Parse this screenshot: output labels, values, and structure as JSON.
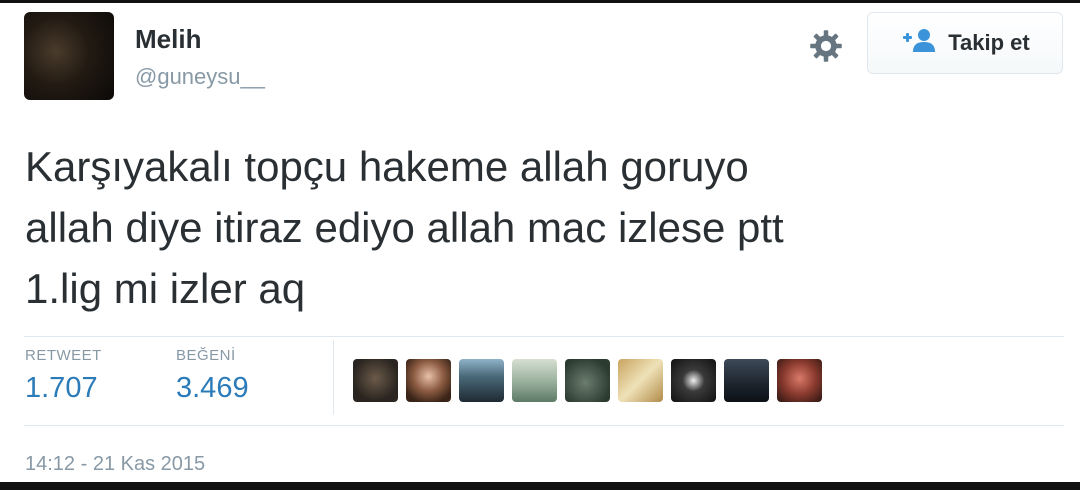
{
  "user": {
    "display_name": "Melih",
    "username": "@guneysu__"
  },
  "actions": {
    "follow_label": "Takip et",
    "follow_icon": "add-user-icon",
    "settings_icon": "gear-icon"
  },
  "tweet": {
    "lines": [
      "Karşıyakalı topçu hakeme allah goruyo",
      "allah diye itiraz ediyo allah mac izlese ptt",
      "1.lig mi izler aq"
    ]
  },
  "stats": {
    "retweet_label": "RETWEET",
    "retweet_count": "1.707",
    "like_label": "BEĞENİ",
    "like_count": "3.469"
  },
  "liked_by_avatar_count": 9,
  "timestamp": "14:12 - 21 Kas 2015",
  "colors": {
    "text": "#292f33",
    "muted": "#8899a6",
    "link": "#2b7bb9",
    "border": "#e1e8ed",
    "follow_icon": "#3b94d9"
  }
}
